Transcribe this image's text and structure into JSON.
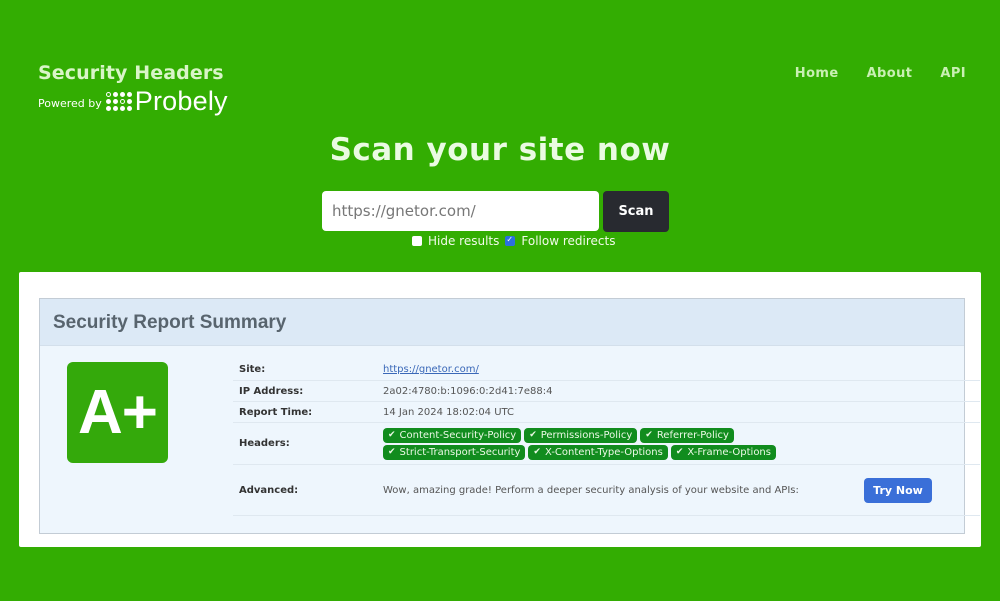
{
  "brand": {
    "title": "Security Headers",
    "powered_by": "Powered by",
    "partner": "Probely"
  },
  "nav": {
    "items": [
      {
        "label": "Home"
      },
      {
        "label": "About"
      },
      {
        "label": "API"
      }
    ]
  },
  "hero": {
    "title": "Scan your site now"
  },
  "scan": {
    "input_value": "https://gnetor.com/",
    "button_label": "Scan",
    "options": [
      {
        "label": "Hide results",
        "checked": false
      },
      {
        "label": "Follow redirects",
        "checked": true
      }
    ]
  },
  "report": {
    "title": "Security Report Summary",
    "grade": "A+",
    "grade_color": "#34a90b",
    "rows": {
      "site": {
        "label": "Site:",
        "value": "https://gnetor.com/"
      },
      "ip": {
        "label": "IP Address:",
        "value": "2a02:4780:b:1096:0:2d41:7e88:4"
      },
      "time": {
        "label": "Report Time:",
        "value": "14 Jan 2024 18:02:04 UTC"
      },
      "headers": {
        "label": "Headers:",
        "items": [
          "Content-Security-Policy",
          "Permissions-Policy",
          "Referrer-Policy",
          "Strict-Transport-Security",
          "X-Content-Type-Options",
          "X-Frame-Options"
        ]
      },
      "advanced": {
        "label": "Advanced:",
        "text": "Wow, amazing grade! Perform a deeper security analysis of your website and APIs:",
        "button_label": "Try Now"
      }
    }
  },
  "colors": {
    "page_bg": "#33ad02",
    "pill_bg": "#118c1e",
    "try_button": "#3a6fd8",
    "scan_button": "#282a30"
  }
}
